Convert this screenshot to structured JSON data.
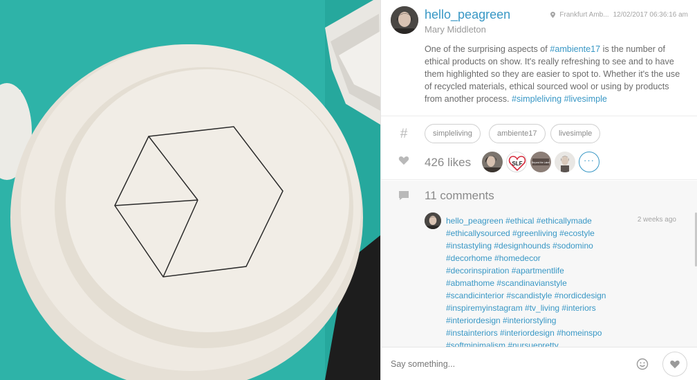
{
  "post": {
    "username": "hello_peagreen",
    "full_name": "Mary Middleton",
    "location": "Frankfurt Amb...",
    "timestamp": "12/02/2017 06:36:16 am",
    "caption_text_1": "One of the surprising aspects of ",
    "caption_tag_1": "#ambiente17",
    "caption_text_2": " is the number of ethical products on show. It's really refreshing to see and to have them highlighted so they are easier to spot to. Whether it's the use of recycled materials, ethical sourced wool or using by products from another process. ",
    "caption_tag_2": "#simpleliving",
    "caption_tag_3": "#livesimple"
  },
  "tags": [
    "simpleliving",
    "ambiente17",
    "livesimple"
  ],
  "likes": {
    "count_label": "426 likes",
    "more_label": "···",
    "liker_badge": "SLF",
    "liker_badge_2": "Beyond the Label"
  },
  "comments": {
    "count_label": "11 comments",
    "items": [
      {
        "username": "hello_peagreen",
        "time": "2 weeks ago",
        "lines": [
          "#ethical #ethicallymade",
          "#ethicallysourced #greenliving #ecostyle",
          "#instastyling #designhounds #sodomino",
          "#decorhome #homedecor",
          "#decorinspiration #apartmentlife",
          "#abmathome #scandinavianstyle",
          "#scandicinterior #scandistyle #nordicdesign",
          "#inspiremyinstagram #tv_living #interiors",
          "#interiordesign #interiorstyling",
          "#instainteriors #interiordesign #homeinspo",
          "#softminimalism #nursuepretty"
        ]
      }
    ]
  },
  "composer": {
    "placeholder": "Say something..."
  },
  "icons": {
    "location": "location-pin-icon",
    "hashtag": "hashtag-icon",
    "likes": "heart-icon",
    "comments": "comment-bubble-icon",
    "emoji": "smiley-icon",
    "like_button": "heart-icon"
  },
  "colors": {
    "accent": "#3897c5",
    "photo_background": "#2fb5aa",
    "plate": "#efeae2"
  }
}
